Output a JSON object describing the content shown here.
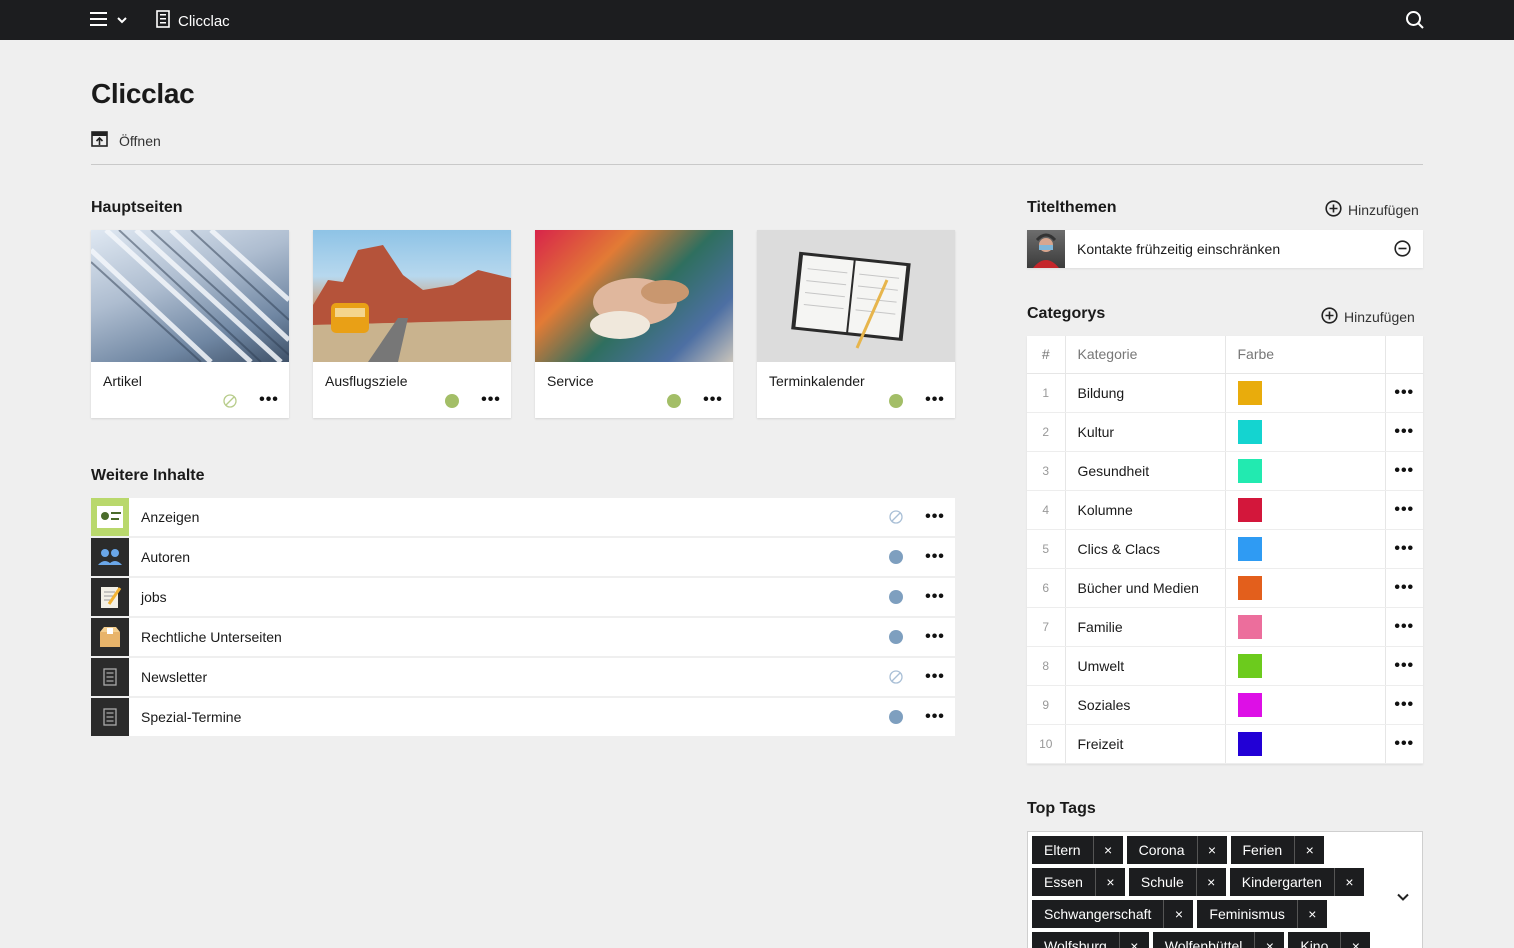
{
  "topbar": {
    "app_title": "Clicclac"
  },
  "page": {
    "title": "Clicclac",
    "open_label": "Öffnen"
  },
  "main_pages": {
    "heading": "Hauptseiten",
    "items": [
      {
        "label": "Artikel",
        "status": "inactive"
      },
      {
        "label": "Ausflugsziele",
        "status": "active"
      },
      {
        "label": "Service",
        "status": "active"
      },
      {
        "label": "Terminkalender",
        "status": "active"
      }
    ]
  },
  "more_content": {
    "heading": "Weitere Inhalte",
    "items": [
      {
        "label": "Anzeigen",
        "status": "inactive"
      },
      {
        "label": "Autoren",
        "status": "active"
      },
      {
        "label": "jobs",
        "status": "active"
      },
      {
        "label": "Rechtliche Unterseiten",
        "status": "active"
      },
      {
        "label": "Newsletter",
        "status": "inactive"
      },
      {
        "label": "Spezial-Termine",
        "status": "active"
      }
    ]
  },
  "title_topics": {
    "heading": "Titelthemen",
    "add_label": "Hinzufügen",
    "items": [
      {
        "label": "Kontakte frühzeitig einschränken"
      }
    ]
  },
  "categories": {
    "heading": "Categorys",
    "add_label": "Hinzufügen",
    "columns": [
      "#",
      "Kategorie",
      "Farbe"
    ],
    "rows": [
      {
        "num": "1",
        "name": "Bildung",
        "color": "#e9ac0c"
      },
      {
        "num": "2",
        "name": "Kultur",
        "color": "#14d4d0"
      },
      {
        "num": "3",
        "name": "Gesundheit",
        "color": "#22eab0"
      },
      {
        "num": "4",
        "name": "Kolumne",
        "color": "#d3173b"
      },
      {
        "num": "5",
        "name": "Clics & Clacs",
        "color": "#2f9bf3"
      },
      {
        "num": "6",
        "name": "Bücher und Medien",
        "color": "#e35f1c"
      },
      {
        "num": "7",
        "name": "Familie",
        "color": "#ec6e9c"
      },
      {
        "num": "8",
        "name": "Umwelt",
        "color": "#6ccb1d"
      },
      {
        "num": "9",
        "name": "Soziales",
        "color": "#dd0fe6"
      },
      {
        "num": "10",
        "name": "Freizeit",
        "color": "#2200d6"
      }
    ]
  },
  "top_tags": {
    "heading": "Top Tags",
    "tags": [
      "Eltern",
      "Corona",
      "Ferien",
      "Essen",
      "Schule",
      "Kindergarten",
      "Schwangerschaft",
      "Feminismus",
      "Wolfsburg",
      "Wolfenbüttel",
      "Kino"
    ]
  },
  "icons": {
    "menu": "menu-icon",
    "search": "search-icon",
    "page": "document-icon",
    "open": "open-icon",
    "more": "more-icon",
    "add": "add-icon",
    "remove": "remove-icon"
  }
}
